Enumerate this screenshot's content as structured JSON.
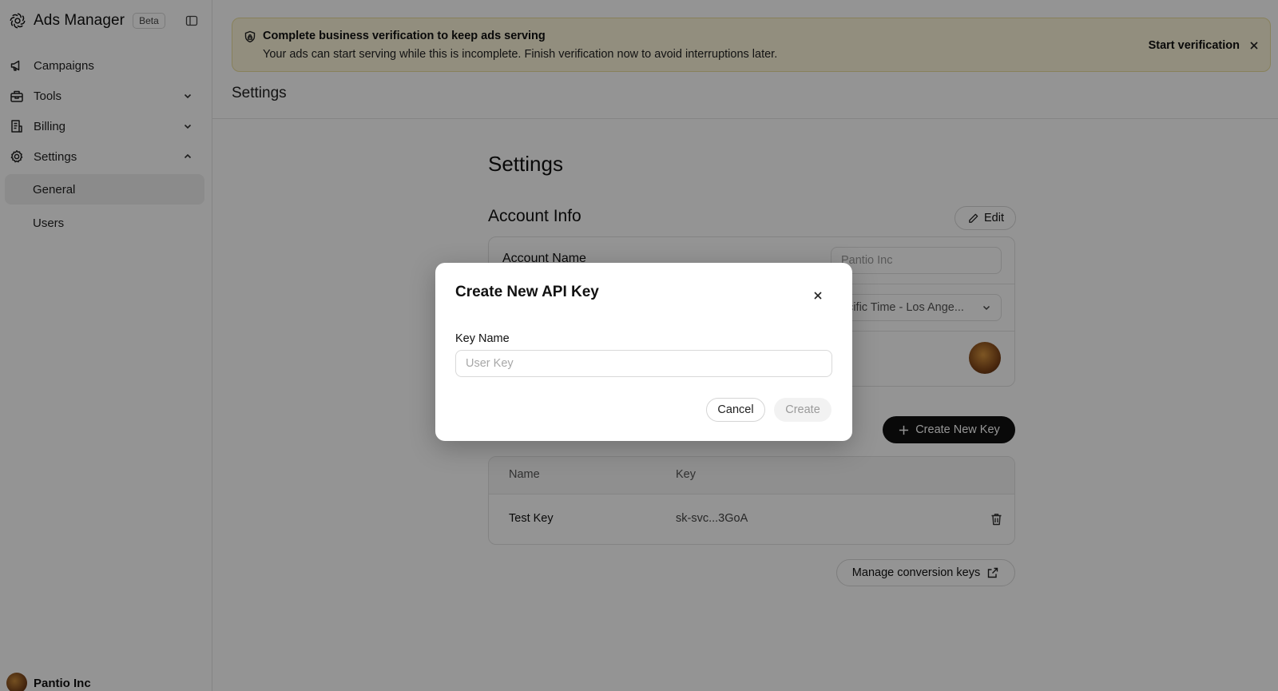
{
  "sidebar": {
    "brand": {
      "title": "Ads Manager",
      "badge": "Beta",
      "logo_icon": "openai-logo-icon",
      "collapse_icon": "sidebar-toggle-icon"
    },
    "nav": [
      {
        "label": "Campaigns",
        "icon": "megaphone-icon"
      },
      {
        "label": "Tools",
        "icon": "toolbox-icon",
        "expanded": false
      },
      {
        "label": "Billing",
        "icon": "receipt-icon",
        "expanded": false
      },
      {
        "label": "Settings",
        "icon": "gear-icon",
        "expanded": true
      }
    ],
    "settings_sub": [
      {
        "label": "General",
        "active": true
      },
      {
        "label": "Users",
        "active": false
      }
    ],
    "profile": {
      "name": "Pantio Inc"
    }
  },
  "banner": {
    "title": "Complete business verification to keep ads serving",
    "text": "Your ads can start serving while this is incomplete. Finish verification now to avoid interruptions later.",
    "action": "Start verification"
  },
  "header": {
    "title": "Settings"
  },
  "settings": {
    "title": "Settings",
    "account_info": {
      "title": "Account Info",
      "edit_label": "Edit",
      "account_name_label": "Account Name",
      "account_name_value": "Pantio Inc",
      "timezone_value": "acific Time - Los Ange..."
    },
    "api_keys": {
      "create_label": "Create New Key",
      "columns": [
        "Name",
        "Key"
      ],
      "rows": [
        {
          "name": "Test Key",
          "key": "sk-svc...3GoA"
        }
      ]
    },
    "manage_label": "Manage conversion keys"
  },
  "modal": {
    "title": "Create New API Key",
    "field_label": "Key Name",
    "placeholder": "User Key",
    "value": "",
    "cancel_label": "Cancel",
    "create_label": "Create"
  },
  "colors": {
    "banner_bg": "#fbf4d9",
    "primary_button": "#111111",
    "overlay": "rgba(0,0,0,0.42)"
  }
}
